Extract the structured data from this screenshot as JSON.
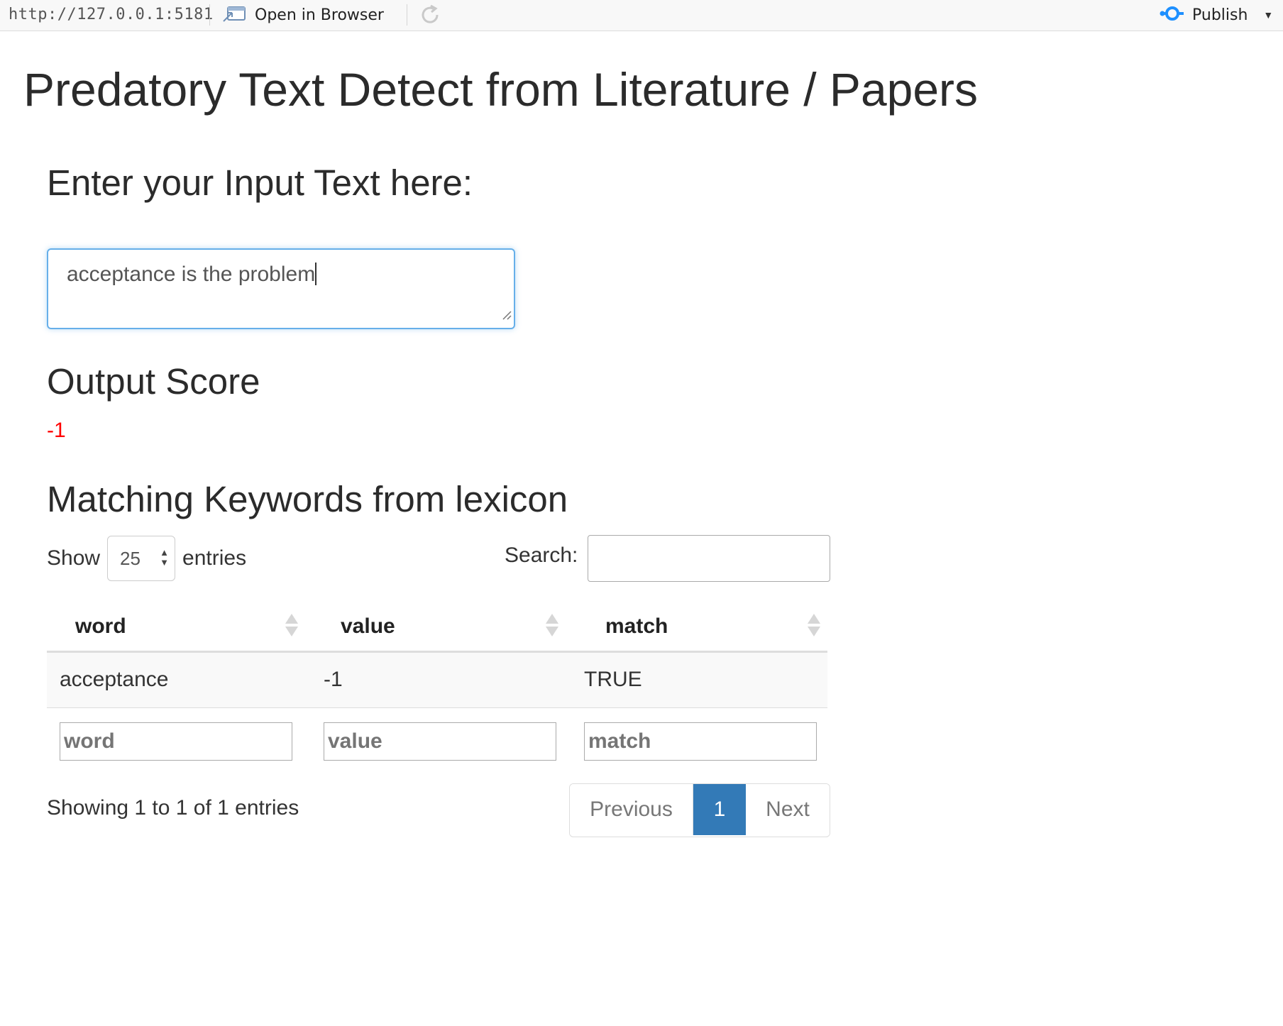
{
  "toolbar": {
    "url": "http://127.0.0.1:5181",
    "open_in_browser": "Open in Browser",
    "publish": "Publish",
    "icons": [
      "open-in-browser-icon",
      "refresh-icon",
      "publish-icon",
      "chevron-down-icon"
    ]
  },
  "page": {
    "title": "Predatory Text Detect from Literature / Papers"
  },
  "input_section": {
    "heading": "Enter your Input Text here:",
    "value": "acceptance is the problem"
  },
  "output_section": {
    "heading": "Output Score",
    "score": "-1",
    "score_color": "#ff0000"
  },
  "keywords_section": {
    "heading": "Matching Keywords from lexicon",
    "length": {
      "show": "Show",
      "selected": "25",
      "entries": "entries"
    },
    "search_label": "Search:",
    "columns": [
      "word",
      "value",
      "match"
    ],
    "rows": [
      [
        "acceptance",
        "-1",
        "TRUE"
      ]
    ],
    "filter_placeholders": [
      "word",
      "value",
      "match"
    ],
    "info": "Showing 1 to 1 of 1 entries",
    "pagination": {
      "previous": "Previous",
      "current": "1",
      "next": "Next"
    },
    "active_page_color": "#337ab7"
  }
}
